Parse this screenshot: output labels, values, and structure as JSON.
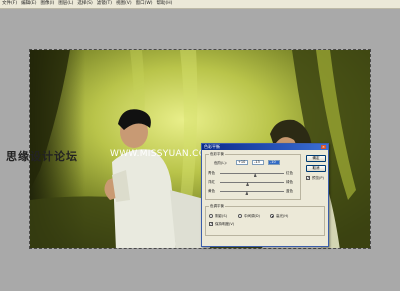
{
  "menu": [
    "文件(F)",
    "编辑(E)",
    "图像(I)",
    "图层(L)",
    "选择(S)",
    "滤镜(T)",
    "视图(V)",
    "窗口(W)",
    "帮助(H)"
  ],
  "watermark": {
    "cn": "思缘设计论坛",
    "url": "WWW.MISSYUAN.COM"
  },
  "dialog": {
    "title": "色彩平衡",
    "balance_group": "色彩平衡",
    "levels_label": "色阶(L):",
    "levels": [
      "+10",
      "-13",
      "-10"
    ],
    "rows": [
      {
        "left": "青色",
        "right": "红色",
        "value": 0.55
      },
      {
        "left": "洋红",
        "right": "绿色",
        "value": 0.43
      },
      {
        "left": "黄色",
        "right": "蓝色",
        "value": 0.42
      }
    ],
    "tone_group": "色调平衡",
    "tones": [
      {
        "label": "阴影(S)",
        "checked": false
      },
      {
        "label": "中间调(D)",
        "checked": false
      },
      {
        "label": "高光(H)",
        "checked": true
      }
    ],
    "preserve_label": "保持明度(V)",
    "preserve_checked": true,
    "ok_label": "确定",
    "cancel_label": "取消",
    "preview_label": "预览(P)",
    "preview_checked": true
  }
}
